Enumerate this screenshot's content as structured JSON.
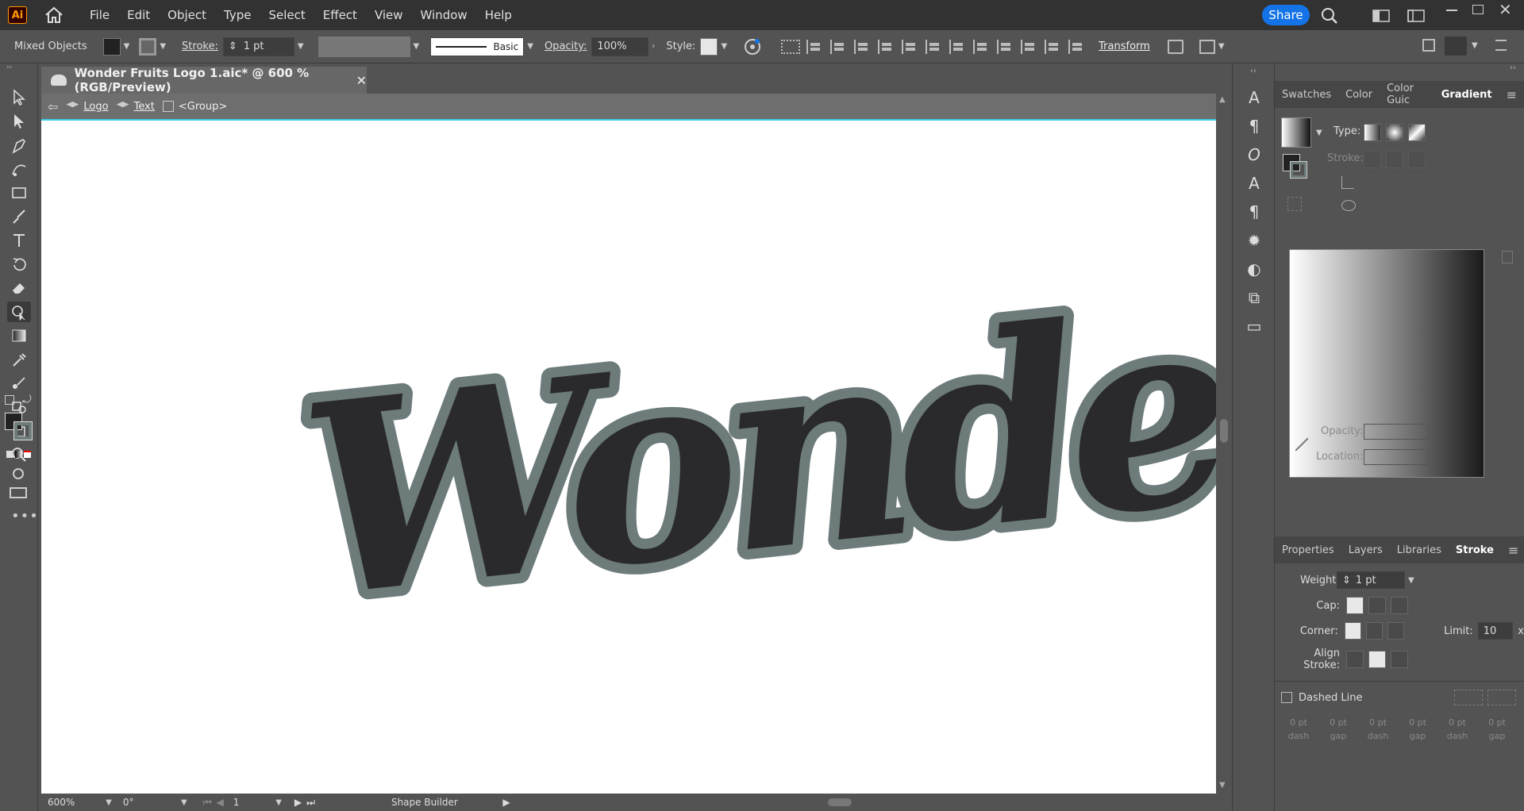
{
  "app": {
    "logo": "Ai"
  },
  "menu": [
    "File",
    "Edit",
    "Object",
    "Type",
    "Select",
    "Effect",
    "View",
    "Window",
    "Help"
  ],
  "share_label": "Share",
  "control_bar": {
    "selection": "Mixed Objects",
    "stroke_label": "Stroke:",
    "stroke_value": "1 pt",
    "brush_label": "Basic",
    "opacity_label": "Opacity:",
    "opacity_value": "100%",
    "style_label": "Style:",
    "transform_label": "Transform"
  },
  "document": {
    "tab_title": "Wonder Fruits Logo 1.aic* @ 600 % (RGB/Preview)",
    "breadcrumb": [
      "Logo",
      "Text",
      "<Group>"
    ],
    "artwork_text": "Wonde"
  },
  "status": {
    "zoom": "600%",
    "rotation": "0°",
    "artboard": "1",
    "tool": "Shape Builder"
  },
  "gradient_panel": {
    "tabs": [
      "Swatches",
      "Color",
      "Color Guic",
      "Gradient"
    ],
    "type_label": "Type:",
    "stroke_label": "Stroke:",
    "opacity_label": "Opacity:",
    "location_label": "Location:"
  },
  "stroke_panel": {
    "tabs": [
      "Properties",
      "Layers",
      "Libraries",
      "Stroke"
    ],
    "weight_label": "Weight:",
    "weight_value": "1 pt",
    "cap_label": "Cap:",
    "corner_label": "Corner:",
    "limit_label": "Limit:",
    "limit_value": "10",
    "limit_unit": "x",
    "align_label": "Align Stroke:",
    "dashed_label": "Dashed Line",
    "dash_fields": [
      {
        "value": "0 pt",
        "label": "dash"
      },
      {
        "value": "0 pt",
        "label": "gap"
      },
      {
        "value": "0 pt",
        "label": "dash"
      },
      {
        "value": "0 pt",
        "label": "gap"
      },
      {
        "value": "0 pt",
        "label": "dash"
      },
      {
        "value": "0 pt",
        "label": "gap"
      }
    ]
  },
  "colors": {
    "accent": "#1473e6",
    "letter_fill": "#2a2a2c",
    "letter_stroke": "#6e7b7b"
  }
}
